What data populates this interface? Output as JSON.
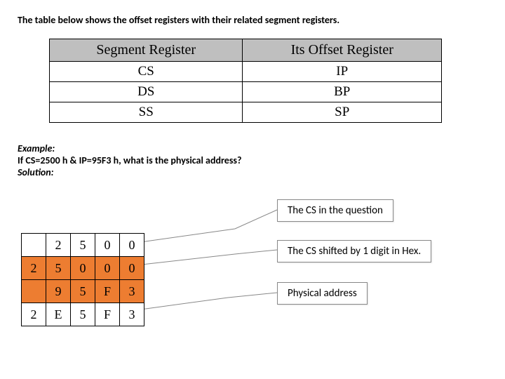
{
  "intro": "The table below shows the offset registers with their related segment registers.",
  "reg_table": {
    "headers": [
      "Segment Register",
      "Its Offset Register"
    ],
    "rows": [
      [
        "CS",
        "IP"
      ],
      [
        "DS",
        "BP"
      ],
      [
        "SS",
        "SP"
      ]
    ]
  },
  "example": {
    "label": "Example:",
    "question": "If CS=2500 h & IP=95F3 h, what is the physical address?",
    "solution_label": "Solution:"
  },
  "calc": {
    "r1": [
      "",
      "2",
      "5",
      "0",
      "0"
    ],
    "r2": [
      "2",
      "5",
      "0",
      "0",
      "0"
    ],
    "r3": [
      "",
      "9",
      "5",
      "F",
      "3"
    ],
    "r4": [
      "2",
      "E",
      "5",
      "F",
      "3"
    ]
  },
  "annotations": {
    "a1": "The CS in the question",
    "a2": "The CS shifted by 1 digit in Hex.",
    "a3": "Physical address"
  }
}
